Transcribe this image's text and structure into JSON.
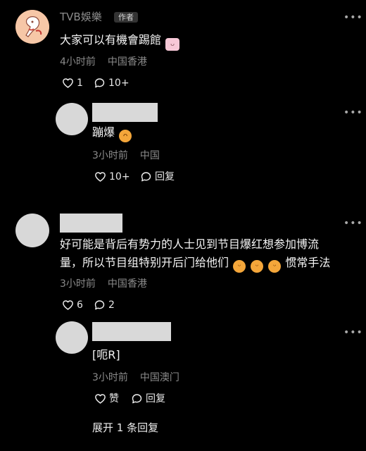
{
  "comments": [
    {
      "author": "TVB娛樂",
      "author_badge": "作者",
      "text": "大家可以有機會踢館",
      "time": "4小时前",
      "location": "中国香港",
      "likes": "1",
      "replies": "10+"
    },
    {
      "author": "",
      "text": "蹦爆",
      "time": "3小时前",
      "location": "中国",
      "likes": "10+",
      "reply_label": "回复"
    },
    {
      "author": "",
      "text_line1": "好可能是背后有势力的人士见到节目爆红想参加博流",
      "text_line2_part1": "量，所以节目组特别开后门给他们",
      "text_line2_part2": "惯常手法",
      "time": "3小时前",
      "location": "中国香港",
      "likes": "6",
      "replies": "2"
    },
    {
      "author": "",
      "text": "[呃R]",
      "time": "3小时前",
      "location": "中国澳门",
      "like_label": "赞",
      "reply_label": "回复"
    }
  ],
  "expand_replies": "展开 1 条回复",
  "icons": {
    "like": "heart-icon",
    "comment": "comment-bubble-icon",
    "more": "more-icon",
    "emoji_angry": "angry-face-emoji",
    "emoji_grin": "grinning-face-emoji"
  },
  "colors": {
    "background": "#000000",
    "text": "#f4f4f4",
    "meta": "#8a8a8a",
    "placeholder": "#d9d9d9"
  }
}
